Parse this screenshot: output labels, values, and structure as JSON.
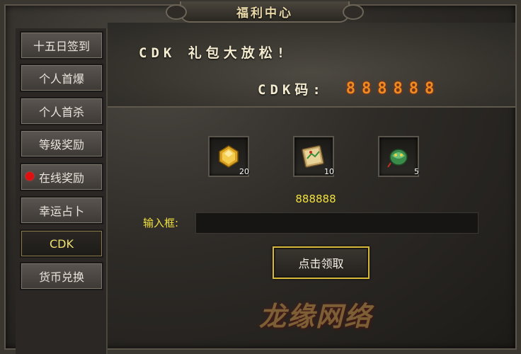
{
  "panel": {
    "title": "福利中心"
  },
  "sidebar": {
    "items": [
      {
        "label": "十五日签到"
      },
      {
        "label": "个人首爆"
      },
      {
        "label": "个人首杀"
      },
      {
        "label": "等级奖励"
      },
      {
        "label": "在线奖励",
        "badge": "red-dot"
      },
      {
        "label": "幸运占卜"
      },
      {
        "label": "CDK",
        "active": true
      },
      {
        "label": "货币兑换"
      }
    ]
  },
  "banner": {
    "title": "CDK 礼包大放松!",
    "cdk_label": "CDK码:",
    "cdk_value": "888888"
  },
  "rewards": [
    {
      "icon": "gold-gem-icon",
      "count": "20"
    },
    {
      "icon": "scroll-map-icon",
      "count": "10"
    },
    {
      "icon": "jade-dragon-icon",
      "count": "5"
    }
  ],
  "form": {
    "code_text": "888888",
    "input_label": "输入框:",
    "input_value": "",
    "claim_label": "点击领取"
  },
  "watermark": "龙缘网络",
  "colors": {
    "accent_yellow": "#f0e040",
    "cdk_orange": "#f08a20",
    "button_border_gold": "#d8b838",
    "badge_red": "#e01010"
  }
}
